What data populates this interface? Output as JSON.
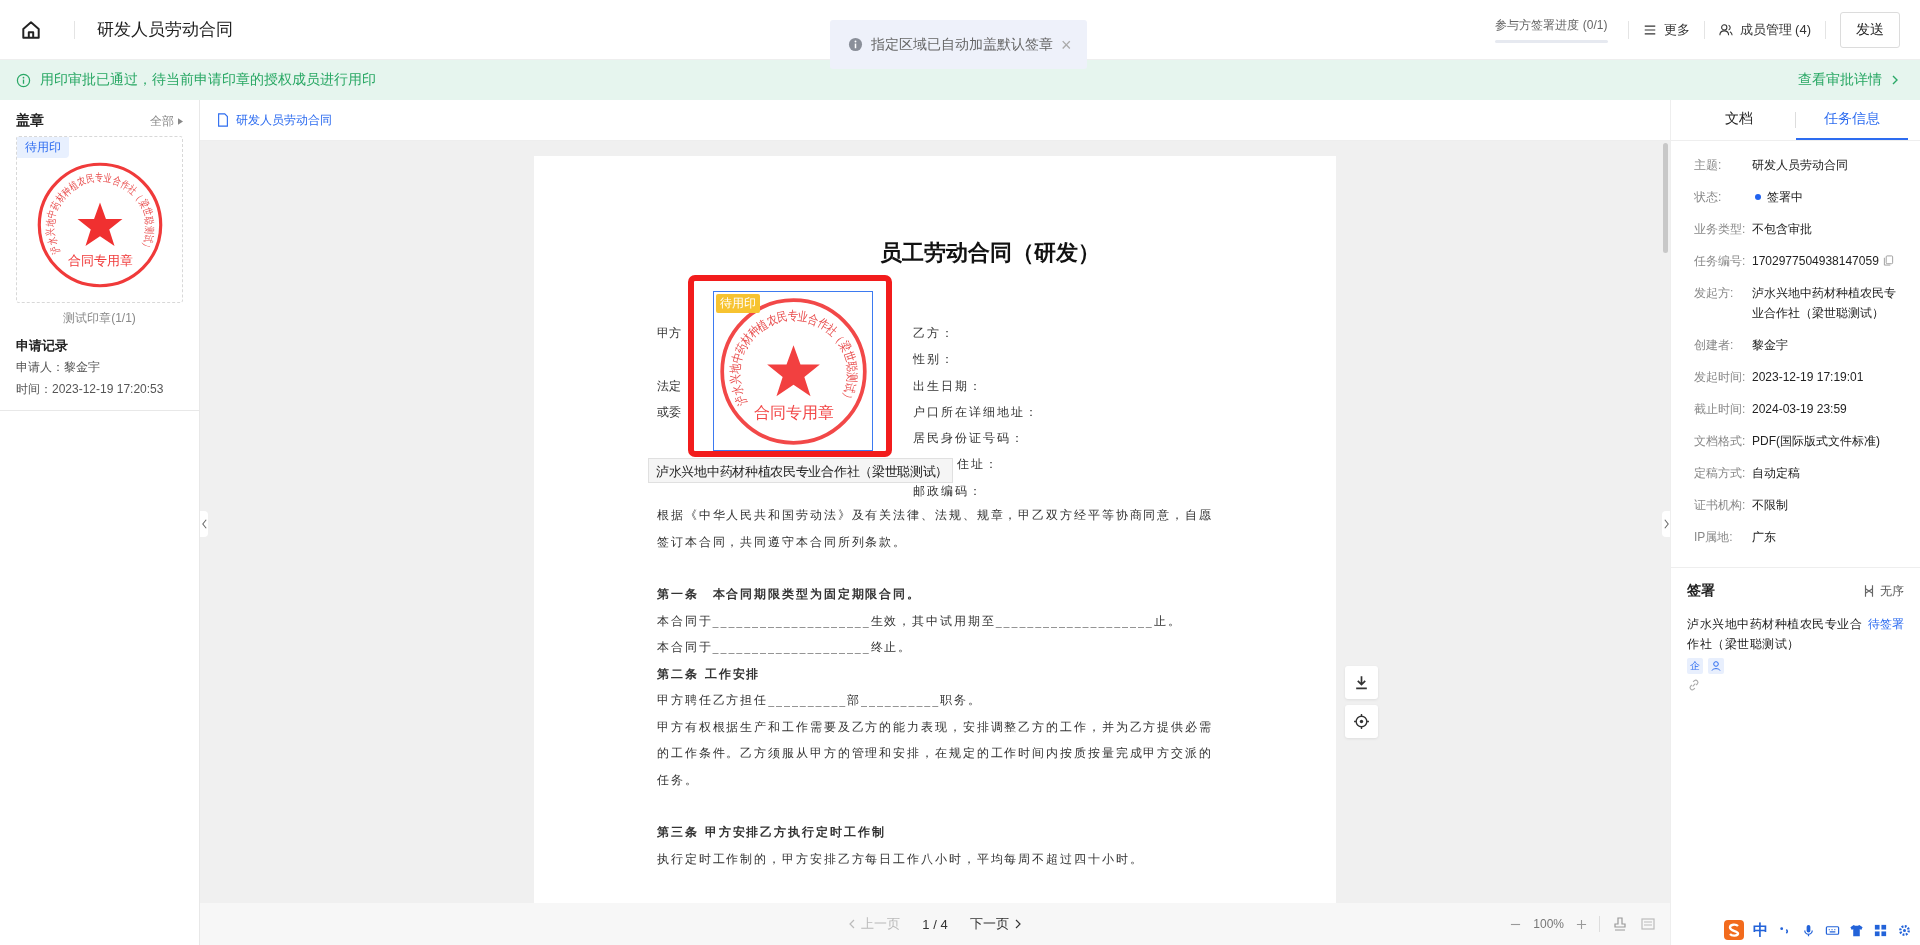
{
  "header": {
    "title": "研发人员劳动合同",
    "progress": {
      "label": "参与方签署进度 (0/1)",
      "level": 0
    },
    "more": "更多",
    "members": "成员管理 (4)",
    "send": "发送"
  },
  "toast": {
    "text": "指定区域已自动加盖默认签章",
    "close": "×"
  },
  "banner": {
    "message": "用印审批已通过，待当前申请印章的授权成员进行用印",
    "link": "查看审批详情"
  },
  "sidebar": {
    "title": "盖章",
    "filter": "全部",
    "seal": {
      "badge": "待用印",
      "ring_text": "泸水兴地中药材种植农民专业合作社（梁世聪测试）",
      "center_text": "合同专用章",
      "caption": "测试印章(1/1)"
    },
    "record": {
      "title": "申请记录",
      "lines": [
        "申请人：黎金宇",
        "时间：2023-12-19 17:20:53"
      ]
    }
  },
  "document": {
    "tab": "研发人员劳动合同",
    "title": "员工劳动合同（研发）",
    "stamp": {
      "badge": "待用印",
      "ring_text": "泸水兴地中药材种植农民专业合作社（梁世聪测试）",
      "center_text": "合同专用章",
      "signer": "泸水兴地中药材种植农民专业合作社（梁世聪测试）"
    },
    "party_rows": [
      {
        "left": "甲方",
        "right": "乙方："
      },
      {
        "right": "性别："
      },
      {
        "left": "法定",
        "right": "出生日期："
      },
      {
        "left": "或委",
        "right": "户口所在详细地址："
      },
      {
        "right": "居民身份证号码："
      },
      {
        "right": "住址："
      },
      {
        "right": "邮政编码："
      }
    ],
    "blocks": [
      {
        "kind": "text",
        "spaced": false,
        "text": "根据《中华人民共和国劳动法》及有关法律、法规、规章，甲乙双方经平等协商同意，自愿签订本合同，共同遵守本合同所列条款。"
      },
      {
        "kind": "heading",
        "spaced": true,
        "text": "第一条　本合同期限类型为固定期限合同。"
      },
      {
        "kind": "text",
        "spaced": false,
        "text": "本合同于____________________生效，其中试用期至____________________止。"
      },
      {
        "kind": "text",
        "spaced": false,
        "text": "本合同于____________________终止。"
      },
      {
        "kind": "heading",
        "spaced": false,
        "text": "第二条 工作安排"
      },
      {
        "kind": "text",
        "spaced": false,
        "text": "甲方聘任乙方担任__________部__________职务。"
      },
      {
        "kind": "text",
        "spaced": false,
        "text": "甲方有权根据生产和工作需要及乙方的能力表现，安排调整乙方的工作，并为乙方提供必需的工作条件。乙方须服从甲方的管理和安排，在规定的工作时间内按质按量完成甲方交派的任务。"
      },
      {
        "kind": "heading",
        "spaced": true,
        "text": "第三条 甲方安排乙方执行定时工作制"
      },
      {
        "kind": "text",
        "spaced": false,
        "text": "执行定时工作制的，甲方安排乙方每日工作八小时，平均每周不超过四十小时。"
      }
    ]
  },
  "pager": {
    "prev": {
      "label": "上一页",
      "disabled": true
    },
    "page": "1 / 4",
    "next": {
      "label": "下一页",
      "disabled": false
    },
    "zoom": "100%"
  },
  "panel": {
    "tabs": [
      {
        "label": "文档",
        "selected": false
      },
      {
        "label": "任务信息",
        "selected": true
      }
    ],
    "info": [
      {
        "kind": "text",
        "label": "主题:",
        "value": "研发人员劳动合同"
      },
      {
        "kind": "status",
        "label": "状态:",
        "value": "签署中",
        "color": "#2163f0"
      },
      {
        "kind": "text",
        "label": "业务类型:",
        "value": "不包含审批"
      },
      {
        "kind": "copyable",
        "label": "任务编号:",
        "value": "1702977504938147059"
      },
      {
        "kind": "text",
        "label": "发起方:",
        "value": "泸水兴地中药材种植农民专业合作社（梁世聪测试）"
      },
      {
        "kind": "text",
        "label": "创建者:",
        "value": "黎金宇"
      },
      {
        "kind": "text",
        "label": "发起时间:",
        "value": "2023-12-19 17:19:01"
      },
      {
        "kind": "text",
        "label": "截止时间:",
        "value": "2024-03-19 23:59"
      },
      {
        "kind": "text",
        "label": "文档格式:",
        "value": "PDF(国际版式文件标准)"
      },
      {
        "kind": "text",
        "label": "定稿方式:",
        "value": "自动定稿"
      },
      {
        "kind": "text",
        "label": "证书机构:",
        "value": "不限制"
      },
      {
        "kind": "text",
        "label": "IP属地:",
        "value": "广东"
      }
    ],
    "signing": {
      "title": "签署",
      "order": "无序",
      "signer": "泸水兴地中药材种植农民专业合作社（梁世聪测试）",
      "status": "待签署",
      "badge": "企"
    }
  },
  "ime": {
    "lang": "中"
  }
}
